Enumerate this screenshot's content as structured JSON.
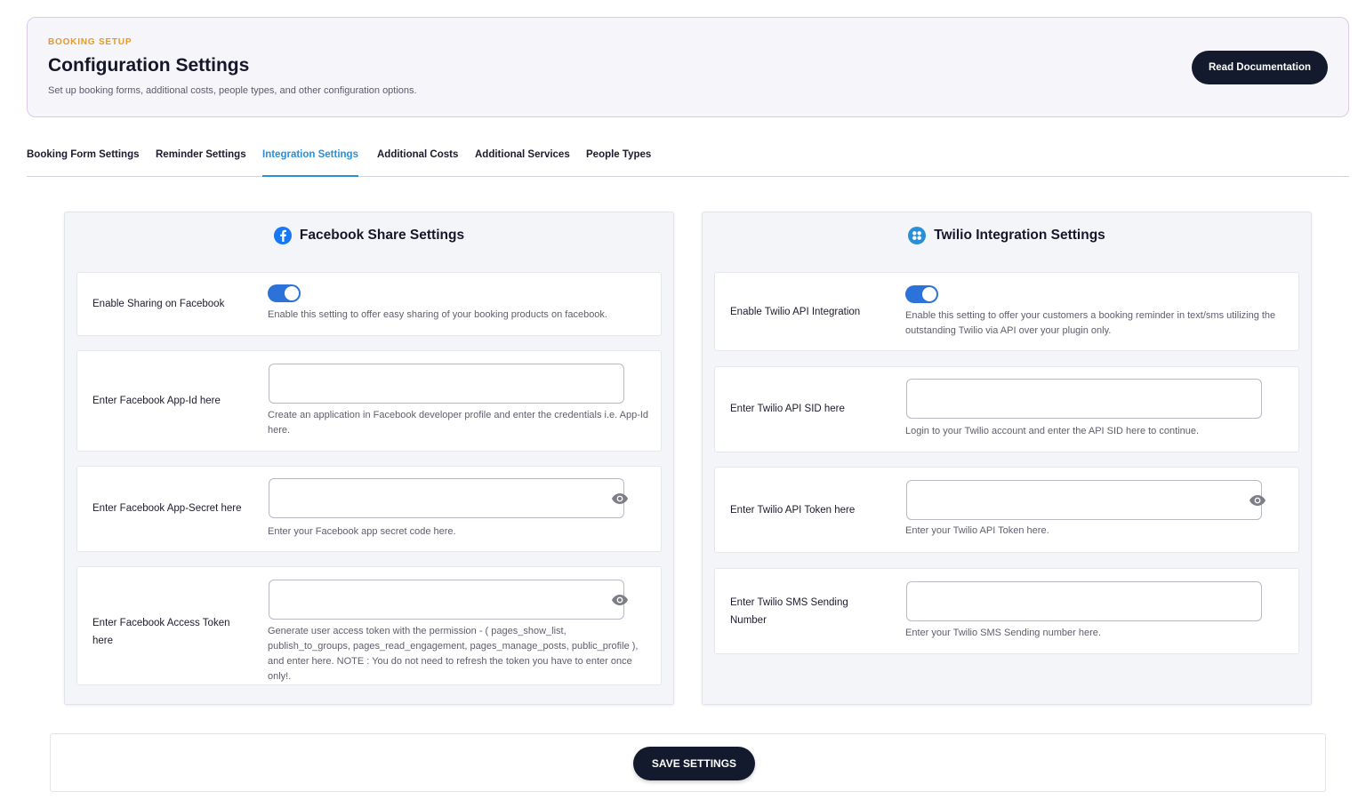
{
  "header": {
    "eyebrow": "BOOKING SETUP",
    "title": "Configuration Settings",
    "subtitle": "Set up booking forms, additional costs, people types, and other configuration options.",
    "doc_button": "Read Documentation"
  },
  "tabs": [
    {
      "label": "Booking Form Settings",
      "active": false
    },
    {
      "label": "Reminder Settings",
      "active": false
    },
    {
      "label": "Integration Settings",
      "active": true
    },
    {
      "label": "Additional Costs",
      "active": false
    },
    {
      "label": "Additional Services",
      "active": false
    },
    {
      "label": "People Types",
      "active": false
    }
  ],
  "facebook": {
    "title": "Facebook Share Settings",
    "icon": "facebook-icon",
    "enable_label": "Enable Sharing on Facebook",
    "enable_on": true,
    "enable_help": "Enable this setting to offer easy sharing of your booking products on facebook.",
    "app_id_label": "Enter Facebook App-Id here",
    "app_id_value": "",
    "app_id_help": "Create an application in Facebook developer profile and enter the credentials i.e. App-Id here.",
    "app_secret_label": "Enter Facebook App-Secret here",
    "app_secret_value": "",
    "app_secret_help": "Enter your Facebook app secret code here.",
    "token_label": "Enter Facebook Access Token here",
    "token_value": "",
    "token_help": "Generate user access token with the permission - ( pages_show_list, publish_to_groups, pages_read_engagement, pages_manage_posts, public_profile ), and enter here. NOTE : You do not need to refresh the token you have to enter once only!."
  },
  "twilio": {
    "title": "Twilio Integration Settings",
    "icon": "twilio-icon",
    "enable_label": "Enable Twilio API Integration",
    "enable_on": true,
    "enable_help": "Enable this setting to offer your customers a booking reminder in text/sms utilizing the outstanding Twilio via API over your plugin only.",
    "sid_label": "Enter Twilio API SID here",
    "sid_value": "",
    "sid_help": "Login to your Twilio account and enter the API SID here to continue.",
    "token_label": "Enter Twilio API Token here",
    "token_value": "",
    "token_help": "Enter your Twilio API Token here.",
    "number_label": "Enter Twilio SMS Sending Number",
    "number_value": "",
    "number_help": "Enter your Twilio SMS Sending number here."
  },
  "footer": {
    "save_button": "SAVE SETTINGS"
  },
  "colors": {
    "accent": "#2b8fd6",
    "eyebrow": "#e39a2d",
    "dark_button": "#131a2e",
    "toggle_on": "#2d72d9"
  }
}
